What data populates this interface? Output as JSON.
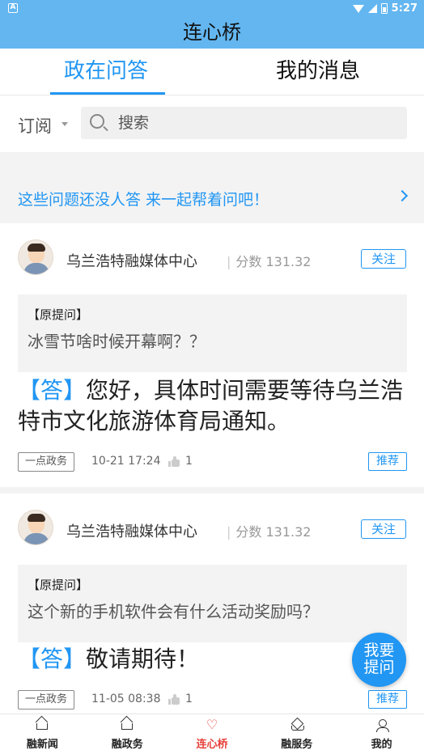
{
  "status_bar": {
    "left_icon": "A",
    "time": "5:27",
    "icons": [
      "wifi-icon",
      "cell-signal-icon",
      "battery-icon"
    ]
  },
  "header": {
    "title": "连心桥"
  },
  "tabs": [
    {
      "label": "政在问答",
      "active": true
    },
    {
      "label": "我的消息",
      "active": false
    }
  ],
  "search": {
    "subscribe_label": "订阅",
    "placeholder": "搜索"
  },
  "banner": {
    "prompt": "这些问题还没人答 来一起帮着问吧！"
  },
  "posts": [
    {
      "author": "乌兰浩特融媒体中心",
      "score": "分数 131.32",
      "follow_label": "关注",
      "question_label": "【原提问】",
      "question": "冰雪节啥时候开幕啊？？",
      "answer_tag": "【答】",
      "answer": "您好，具体时间需要等待乌兰浩特市文化旅游体育局通知。",
      "source": "一点政务",
      "time": "10-21 17:24",
      "likes": "1",
      "recommend_label": "推荐"
    },
    {
      "author": "乌兰浩特融媒体中心",
      "score": "分数 131.32",
      "follow_label": "关注",
      "question_label": "【原提问】",
      "question": "这个新的手机软件会有什么活动奖励吗？",
      "answer_tag": "【答】",
      "answer": "敬请期待！",
      "source": "一点政务",
      "time": "11-05 08:38",
      "likes": "1",
      "recommend_label": "推荐"
    }
  ],
  "fab": {
    "line1": "我要",
    "line2": "提问"
  },
  "bottom_nav": [
    {
      "label": "融新闻",
      "icon": "home-icon",
      "active": false
    },
    {
      "label": "融政务",
      "icon": "home-icon",
      "active": false
    },
    {
      "label": "连心桥",
      "icon": "heart-icon",
      "active": true
    },
    {
      "label": "融服务",
      "icon": "layers-icon",
      "active": false
    },
    {
      "label": "我的",
      "icon": "person-icon",
      "active": false
    }
  ],
  "colors": {
    "header_bg": "#63b6f0",
    "accent": "#2196f3",
    "nav_active": "#e6403a"
  }
}
